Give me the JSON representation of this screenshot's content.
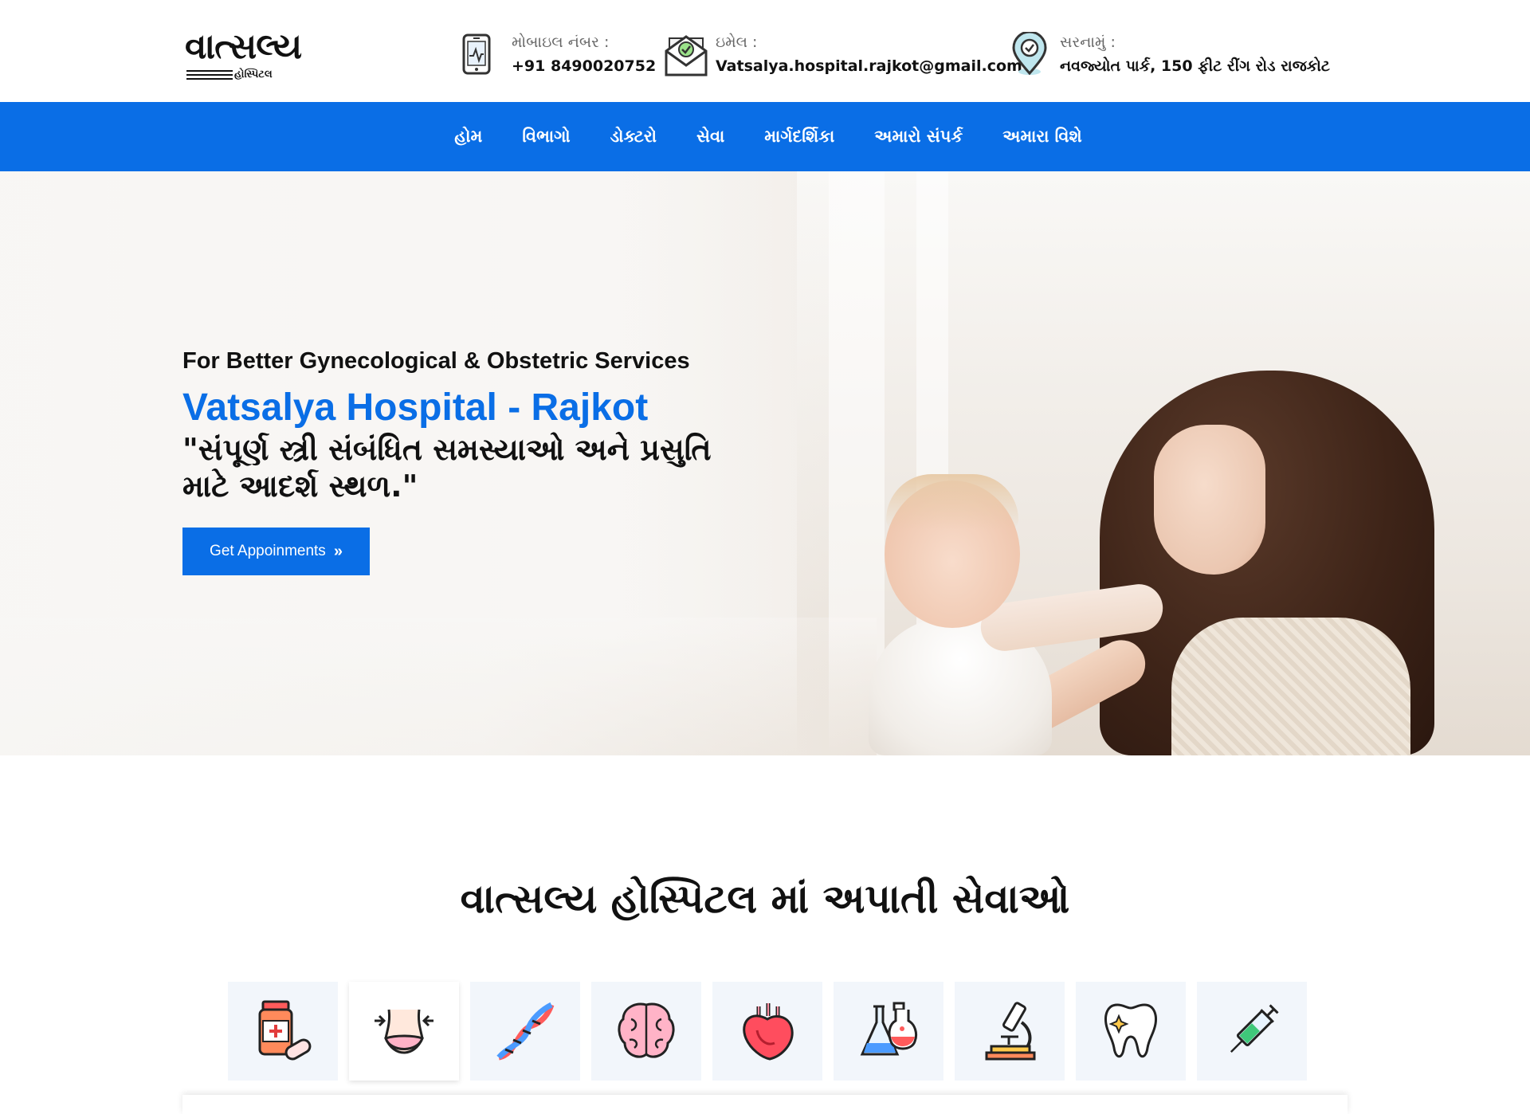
{
  "brand": {
    "logo_script": "વાત્સલ્ય",
    "logo_sub": "હોસ્પિટલ"
  },
  "contact": {
    "phone": {
      "label": "મોબાઇલ નંબર :",
      "value": "+91 8490020752",
      "icon": "phone-icon"
    },
    "email": {
      "label": "ઇમેલ :",
      "value": "Vatsalya.hospital.rajkot@gmail.com",
      "icon": "envelope-icon"
    },
    "address": {
      "label": "સરનામું :",
      "value": "નવજ્યોત પાર્ક, 150 ફીટ રીંગ રોડ રાજકોટ",
      "icon": "location-pin-icon"
    }
  },
  "nav": {
    "items": [
      "હોમ",
      "વિભાગો",
      "ડોક્ટરો",
      "સેવા",
      "માર્ગદર્શિકા",
      "અમારો સંપર્ક",
      "અમારા વિશે"
    ]
  },
  "hero": {
    "tagline": "For Better Gynecological & Obstetric Services",
    "title": "Vatsalya Hospital - Rajkot",
    "quote": "\"સંપૂર્ણ સ્ત્રી સંબંધિત સમસ્યાઓ અને પ્રસુતિ માટે આદર્શ સ્થળ.\"",
    "cta_label": "Get Appoinments",
    "cta_icon": "double-chevron-right-icon"
  },
  "services": {
    "title": "વાત્સલ્ય હોસ્પિટલ માં અપાતી સેવાઓ",
    "icons": [
      "medicine-bottle-icon",
      "waist-icon",
      "dna-icon",
      "brain-icon",
      "heart-icon",
      "flask-icon",
      "microscope-icon",
      "tooth-icon",
      "syringe-icon"
    ],
    "active_index": 1
  },
  "colors": {
    "primary": "#0a6ee6",
    "tile_bg": "#f2f6fb",
    "text": "#111111"
  }
}
